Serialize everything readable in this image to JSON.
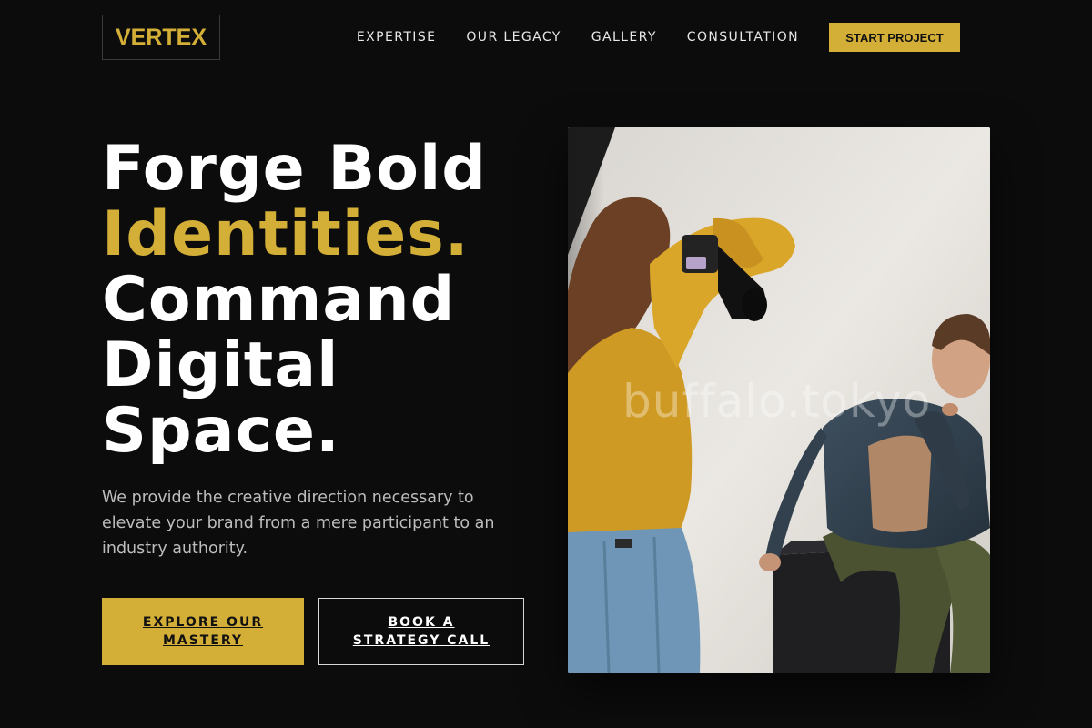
{
  "brand": {
    "logo_text": "VERTEX",
    "accent_color": "#d4af37"
  },
  "nav": {
    "items": [
      {
        "label": "EXPERTISE"
      },
      {
        "label": "OUR LEGACY"
      },
      {
        "label": "GALLERY"
      },
      {
        "label": "CONSULTATION"
      }
    ],
    "cta_label": "START PROJECT"
  },
  "hero": {
    "headline_line1": "Forge Bold",
    "headline_accent": "Identities.",
    "headline_line3": "Command",
    "headline_line4": "Digital",
    "headline_line5": "Space.",
    "subtitle": "We provide the creative direction necessary to elevate your brand from a mere participant to an industry authority.",
    "primary_button": "EXPLORE OUR MASTERY",
    "secondary_button": "BOOK A STRATEGY CALL"
  },
  "image": {
    "watermark": "buffalo.tokyo"
  }
}
